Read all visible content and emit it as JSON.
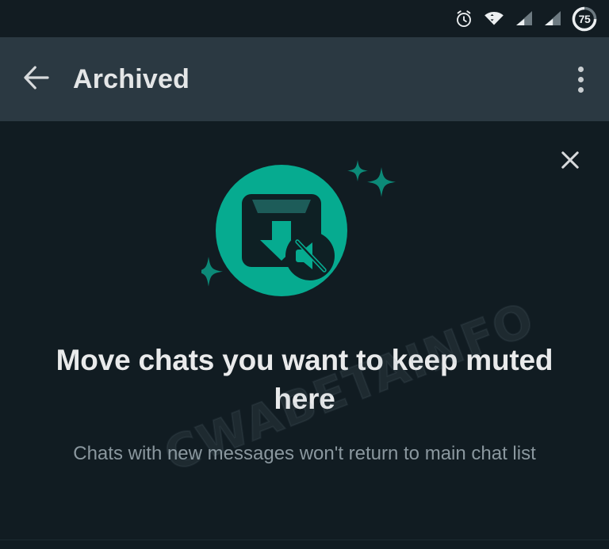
{
  "status_bar": {
    "icons": [
      "alarm-icon",
      "wifi-icon",
      "signal-icon-1",
      "signal-icon-2",
      "battery-icon"
    ],
    "battery_level": "75"
  },
  "app_bar": {
    "title": "Archived",
    "back_icon": "arrow-left-icon",
    "overflow_icon": "more-vertical-icon"
  },
  "main": {
    "close_icon": "close-icon",
    "illustration_name": "archive-muted-illustration",
    "headline": "Move chats you want to keep muted here",
    "subtext": "Chats with new messages won't return to main chat list"
  },
  "watermark": {
    "text": "CWABETAINFO"
  },
  "colors": {
    "status_bar_bg": "#121c22",
    "app_bar_bg": "#2b3942",
    "page_bg": "#111c22",
    "accent_teal": "#06ab90",
    "headline_text": "#e9eaeb",
    "sub_text": "#8a979e"
  }
}
